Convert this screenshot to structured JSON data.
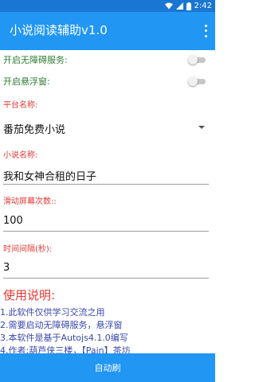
{
  "status_bar": {
    "time": "2:42",
    "icons": [
      "wifi-icon",
      "signal-icon",
      "battery-icon"
    ]
  },
  "app_bar": {
    "title": "小说阅读辅助v1.0",
    "menu_icon": "overflow-menu-icon"
  },
  "settings": {
    "accessibility_label": "开启无障碍服务:",
    "accessibility_on": false,
    "floating_label": "开启悬浮窗:",
    "floating_on": false
  },
  "form": {
    "platform_label": "平台名称:",
    "platform_value": "番茄免费小说",
    "novel_label": "小说名称:",
    "novel_value": "我和女神合租的日子",
    "swipe_label": "滑动屏幕次数::",
    "swipe_value": "100",
    "interval_label": "时间间隔(秒):",
    "interval_value": "3"
  },
  "usage": {
    "title": "使用说明:",
    "notes": [
      "1.此软件仅供学习交流之用",
      "2.需要启动无障碍服务，悬浮窗",
      "3.本软件是基于Autojs4.1.0编写",
      "4.作者:葫芦侠三楼，【Pain】茶坊"
    ]
  },
  "bottom_button": {
    "label": "自动刷"
  },
  "colors": {
    "primary": "#2196f3",
    "primary_dark": "#1976d2",
    "green_label": "#2e7d32",
    "red_label": "#e53935",
    "note_blue": "#3949ab"
  }
}
